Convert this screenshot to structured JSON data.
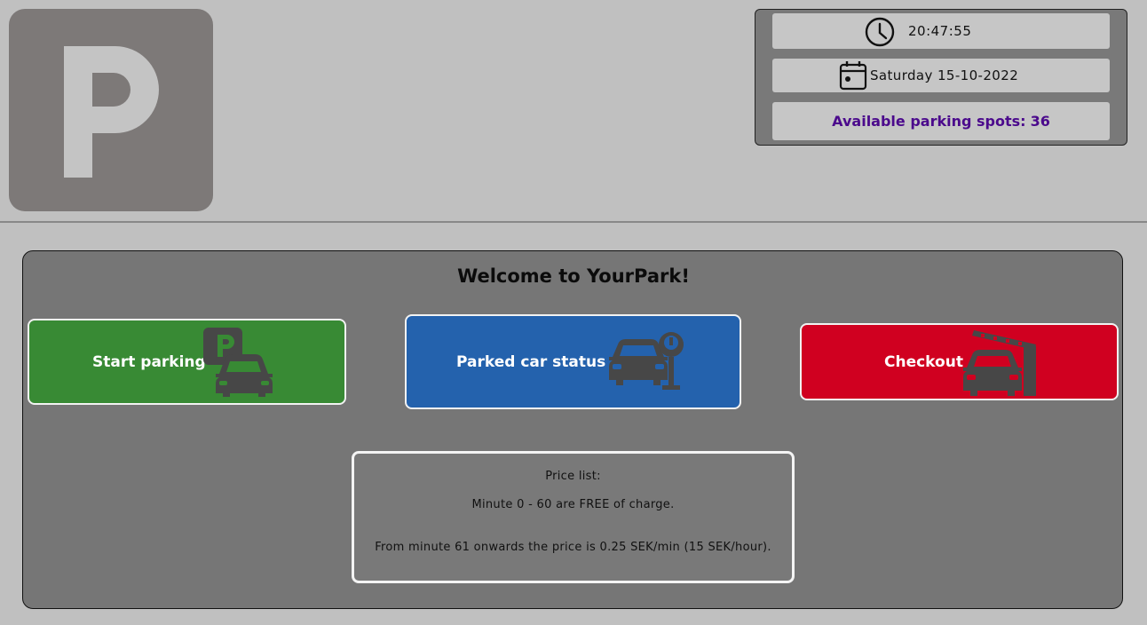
{
  "logo": {
    "letter": "P"
  },
  "info": {
    "time": "20:47:55",
    "date": "Saturday 15-10-2022",
    "spots_label": "Available parking spots:",
    "spots_count": "36"
  },
  "welcome": "Welcome to YourPark!",
  "actions": {
    "start": "Start parking",
    "status": "Parked car status",
    "checkout": "Checkout"
  },
  "price_list": {
    "title": "Price list:",
    "line1": "Minute 0 - 60 are FREE of charge.",
    "line2": "From minute 61 onwards the price is 0.25 SEK/min (15 SEK/hour)."
  },
  "colors": {
    "start": "#388a34",
    "status": "#2462ad",
    "checkout": "#d00020",
    "spots_text": "#4b0a8c"
  },
  "icons": {
    "logo": "parking-p-icon",
    "time": "clock-icon",
    "date": "calendar-icon",
    "start": "parking-car-icon",
    "status": "car-meter-icon",
    "checkout": "car-barrier-icon"
  }
}
